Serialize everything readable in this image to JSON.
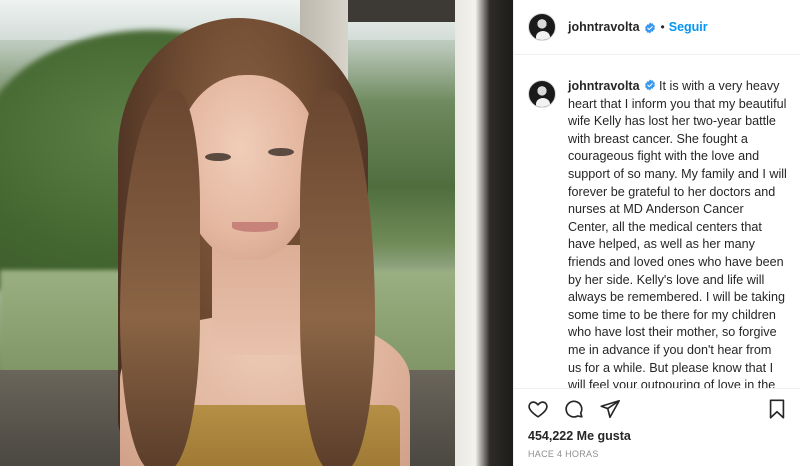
{
  "post": {
    "username": "johntravolta",
    "follow_label": "Seguir",
    "separator": "•",
    "caption": "It is with a very heavy heart that I inform you that my beautiful wife Kelly has lost her two-year battle with breast cancer. She fought a courageous fight with the love and support of so many.  My family and I will forever be grateful to her doctors and nurses at MD Anderson Cancer Center, all the medical centers that have helped, as well as her many friends and loved ones who have been by her side. Kelly's love and life will always be remembered. I will be taking some time to be there for my children who have lost their mother, so forgive me in advance if you don't hear from us for a while.  But please know that I will feel your outpouring of love in the weeks and months ahead as we heal.",
    "likes": "454,222 Me gusta",
    "timestamp": "HACE 4 HORAS"
  },
  "icons": {
    "verified": "verified-badge-icon",
    "like": "heart-icon",
    "comment": "comment-icon",
    "share": "send-icon",
    "save": "bookmark-icon"
  },
  "colors": {
    "link_blue": "#0095f6",
    "verified_blue": "#3897f0",
    "text": "#262626",
    "muted": "#8e8e8e",
    "border": "#efefef"
  }
}
